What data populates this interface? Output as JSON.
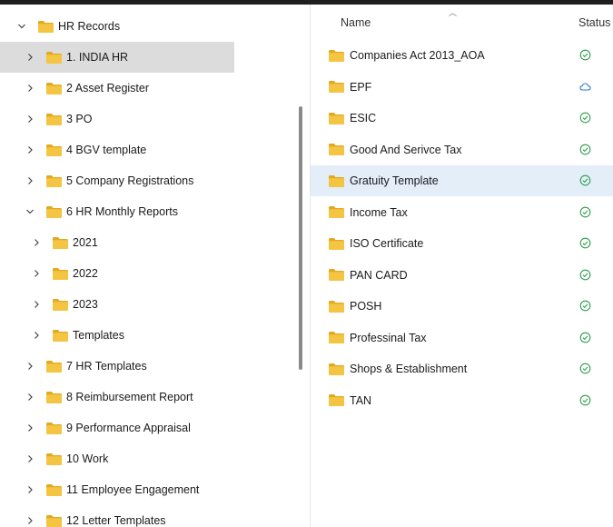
{
  "nav": {
    "root": {
      "label": "HR Records",
      "expanded": true
    },
    "items": [
      {
        "label": "1. INDIA HR",
        "level": 1,
        "expanded": false,
        "selected": true
      },
      {
        "label": "2 Asset Register",
        "level": 1,
        "expanded": false
      },
      {
        "label": "3 PO",
        "level": 1,
        "expanded": false
      },
      {
        "label": "4 BGV template",
        "level": 1,
        "expanded": false
      },
      {
        "label": "5 Company Registrations",
        "level": 1,
        "expanded": false
      },
      {
        "label": "6 HR Monthly Reports",
        "level": 1,
        "expanded": true
      },
      {
        "label": "2021",
        "level": 2,
        "expanded": false
      },
      {
        "label": "2022",
        "level": 2,
        "expanded": false
      },
      {
        "label": "2023",
        "level": 2,
        "expanded": false
      },
      {
        "label": "Templates",
        "level": 2,
        "expanded": false
      },
      {
        "label": "7 HR Templates",
        "level": 1,
        "expanded": false
      },
      {
        "label": "8 Reimbursement Report",
        "level": 1,
        "expanded": false
      },
      {
        "label": "9 Performance Appraisal",
        "level": 1,
        "expanded": false
      },
      {
        "label": "10 Work",
        "level": 1,
        "expanded": false
      },
      {
        "label": "11 Employee Engagement",
        "level": 1,
        "expanded": false
      },
      {
        "label": "12 Letter Templates",
        "level": 1,
        "expanded": false
      }
    ]
  },
  "content": {
    "columns": {
      "name": "Name",
      "status": "Status"
    },
    "files": [
      {
        "name": "Companies Act 2013_AOA",
        "status": "synced"
      },
      {
        "name": "EPF",
        "status": "cloud"
      },
      {
        "name": "ESIC",
        "status": "synced"
      },
      {
        "name": "Good And Serivce Tax",
        "status": "synced"
      },
      {
        "name": "Gratuity Template",
        "status": "synced",
        "selected": true
      },
      {
        "name": "Income Tax",
        "status": "synced"
      },
      {
        "name": "ISO Certificate",
        "status": "synced"
      },
      {
        "name": "PAN CARD",
        "status": "synced"
      },
      {
        "name": "POSH",
        "status": "synced"
      },
      {
        "name": "Professinal Tax",
        "status": "synced"
      },
      {
        "name": "Shops & Establishment",
        "status": "synced"
      },
      {
        "name": "TAN",
        "status": "synced"
      }
    ]
  },
  "colors": {
    "folder": "#F4C542",
    "folder_tab": "#E2A91E",
    "synced": "#2E9E4F",
    "cloud": "#2B7CD3",
    "nav_selected": "#DCDCDC",
    "row_selected": "#E3EEF9"
  }
}
